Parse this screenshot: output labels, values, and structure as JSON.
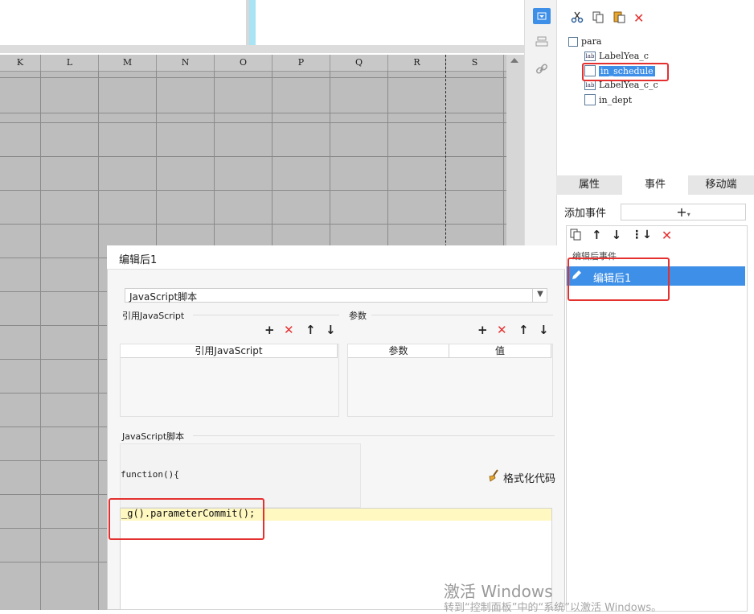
{
  "spreadsheet": {
    "columns": [
      "K",
      "L",
      "M",
      "N",
      "O",
      "P",
      "Q",
      "R",
      "S"
    ]
  },
  "tree": {
    "root": "para",
    "items": [
      {
        "label": "LabelYea_c",
        "icon": "lab"
      },
      {
        "label": "in_schedule",
        "icon": "field"
      },
      {
        "label": "LabelYea_c_c",
        "icon": "lab"
      },
      {
        "label": "in_dept",
        "icon": "field"
      }
    ],
    "icon_lab": "lab"
  },
  "tabs": [
    "属性",
    "事件",
    "移动端"
  ],
  "events": {
    "add_label": "添加事件",
    "add_symbol": "+",
    "group_label": "编辑后事件",
    "item_label": "编辑后1"
  },
  "dialog": {
    "title": "编辑后1",
    "language": "JavaScript脚本",
    "ref_section": "引用JavaScript",
    "ref_table_header": "引用JavaScript",
    "param_section": "参数",
    "param_headers": [
      "参数",
      "值"
    ],
    "script_section": "JavaScript脚本",
    "function_text": "function(){",
    "format_button": "格式化代码",
    "code_line": "_g().parameterCommit();"
  },
  "watermark": {
    "line1": "激活 Windows",
    "line2": "转到“控制面板”中的“系统”以激活 Windows。"
  },
  "colors": {
    "selection": "#3d8fe8",
    "highlight_box": "#e53030",
    "editor_line": "#fff8c0"
  }
}
